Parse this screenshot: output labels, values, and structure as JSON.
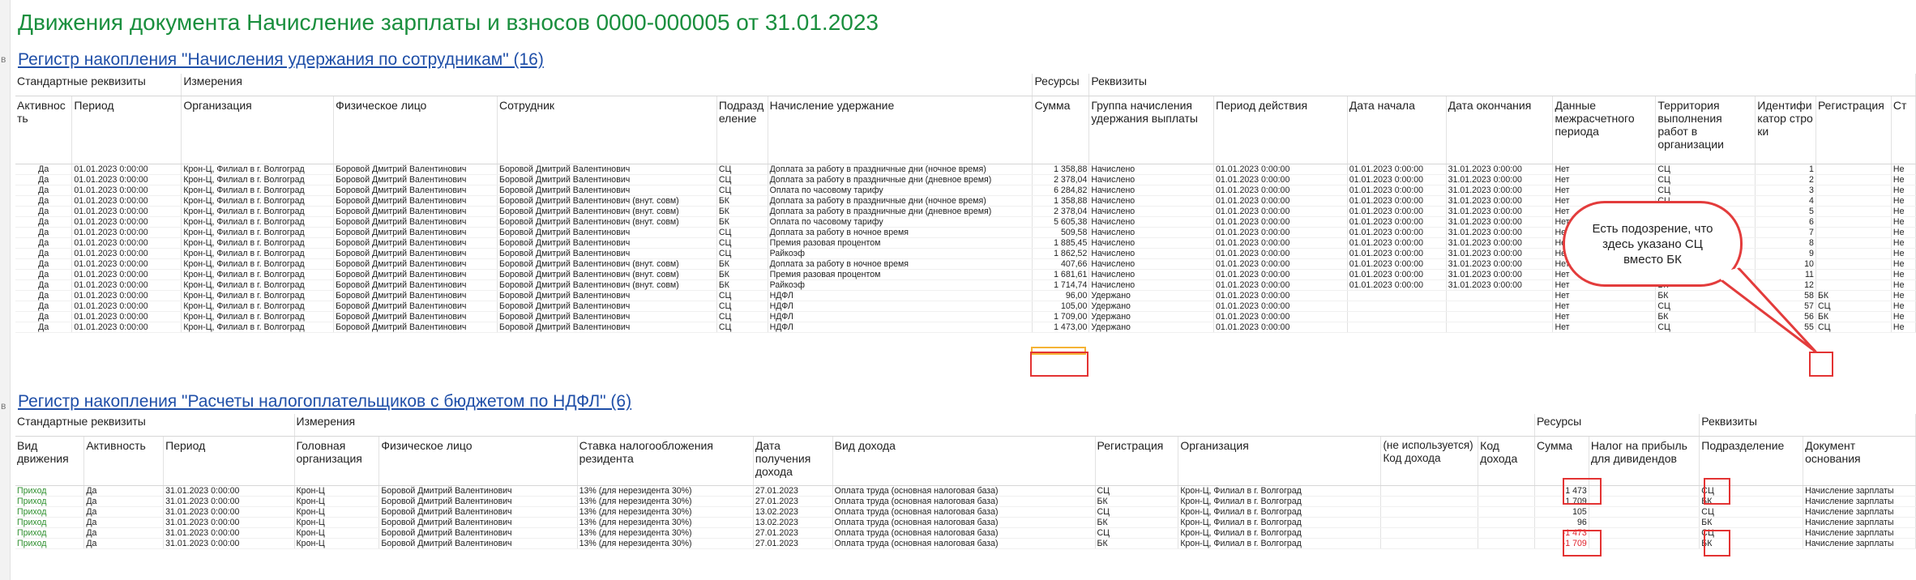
{
  "page": {
    "title": "Движения документа Начисление зарплаты и взносов 0000-000005 от 31.01.2023"
  },
  "register1": {
    "title": "Регистр накопления \"Начисления удержания по сотрудникам\" (16)",
    "groups": [
      "Стандартные реквизиты",
      "Измерения",
      "Ресурсы",
      "Реквизиты"
    ],
    "columns": [
      "Активность",
      "Период",
      "Организация",
      "Физическое лицо",
      "Сотрудник",
      "Подразделение",
      "Начисление удержание",
      "Сумма",
      "Группа начисления удержания выплаты",
      "Период действия",
      "Дата начала",
      "Дата окончания",
      "Данные межрасчетного периода",
      "Территория выполнения работ в организации",
      "Идентификатор строки",
      "Регистрация",
      "Ст"
    ],
    "rows": [
      [
        "Да",
        "01.01.2023 0:00:00",
        "Крон-Ц, Филиал в г. Волгоград",
        "Боровой Дмитрий Валентинович",
        "Боровой Дмитрий Валентинович",
        "СЦ",
        "Доплата за работу в праздничные дни (ночное время)",
        "1 358,88",
        "Начислено",
        "01.01.2023 0:00:00",
        "01.01.2023 0:00:00",
        "31.01.2023 0:00:00",
        "Нет",
        "СЦ",
        "1",
        "",
        "Не"
      ],
      [
        "Да",
        "01.01.2023 0:00:00",
        "Крон-Ц, Филиал в г. Волгоград",
        "Боровой Дмитрий Валентинович",
        "Боровой Дмитрий Валентинович",
        "СЦ",
        "Доплата за работу в праздничные дни (дневное время)",
        "2 378,04",
        "Начислено",
        "01.01.2023 0:00:00",
        "01.01.2023 0:00:00",
        "31.01.2023 0:00:00",
        "Нет",
        "СЦ",
        "2",
        "",
        "Не"
      ],
      [
        "Да",
        "01.01.2023 0:00:00",
        "Крон-Ц, Филиал в г. Волгоград",
        "Боровой Дмитрий Валентинович",
        "Боровой Дмитрий Валентинович",
        "СЦ",
        "Оплата по часовому тарифу",
        "6 284,82",
        "Начислено",
        "01.01.2023 0:00:00",
        "01.01.2023 0:00:00",
        "31.01.2023 0:00:00",
        "Нет",
        "СЦ",
        "3",
        "",
        "Не"
      ],
      [
        "Да",
        "01.01.2023 0:00:00",
        "Крон-Ц, Филиал в г. Волгоград",
        "Боровой Дмитрий Валентинович",
        "Боровой Дмитрий Валентинович (внут. совм)",
        "БК",
        "Доплата за работу в праздничные дни (ночное время)",
        "1 358,88",
        "Начислено",
        "01.01.2023 0:00:00",
        "01.01.2023 0:00:00",
        "31.01.2023 0:00:00",
        "Нет",
        "СЦ",
        "4",
        "",
        "Не"
      ],
      [
        "Да",
        "01.01.2023 0:00:00",
        "Крон-Ц, Филиал в г. Волгоград",
        "Боровой Дмитрий Валентинович",
        "Боровой Дмитрий Валентинович (внут. совм)",
        "БК",
        "Доплата за работу в праздничные дни (дневное время)",
        "2 378,04",
        "Начислено",
        "01.01.2023 0:00:00",
        "01.01.2023 0:00:00",
        "31.01.2023 0:00:00",
        "Нет",
        "СЦ",
        "5",
        "",
        "Не"
      ],
      [
        "Да",
        "01.01.2023 0:00:00",
        "Крон-Ц, Филиал в г. Волгоград",
        "Боровой Дмитрий Валентинович",
        "Боровой Дмитрий Валентинович (внут. совм)",
        "БК",
        "Оплата по часовому тарифу",
        "5 605,38",
        "Начислено",
        "01.01.2023 0:00:00",
        "01.01.2023 0:00:00",
        "31.01.2023 0:00:00",
        "Нет",
        "СЦ",
        "6",
        "",
        "Не"
      ],
      [
        "Да",
        "01.01.2023 0:00:00",
        "Крон-Ц, Филиал в г. Волгоград",
        "Боровой Дмитрий Валентинович",
        "Боровой Дмитрий Валентинович",
        "СЦ",
        "Доплата за работу в ночное время",
        "509,58",
        "Начислено",
        "01.01.2023 0:00:00",
        "01.01.2023 0:00:00",
        "31.01.2023 0:00:00",
        "Нет",
        "СЦ",
        "7",
        "",
        "Не"
      ],
      [
        "Да",
        "01.01.2023 0:00:00",
        "Крон-Ц, Филиал в г. Волгоград",
        "Боровой Дмитрий Валентинович",
        "Боровой Дмитрий Валентинович",
        "СЦ",
        "Премия разовая процентом",
        "1 885,45",
        "Начислено",
        "01.01.2023 0:00:00",
        "01.01.2023 0:00:00",
        "31.01.2023 0:00:00",
        "Нет",
        "СЦ",
        "8",
        "",
        "Не"
      ],
      [
        "Да",
        "01.01.2023 0:00:00",
        "Крон-Ц, Филиал в г. Волгоград",
        "Боровой Дмитрий Валентинович",
        "Боровой Дмитрий Валентинович",
        "СЦ",
        "Райкоэф",
        "1 862,52",
        "Начислено",
        "01.01.2023 0:00:00",
        "01.01.2023 0:00:00",
        "31.01.2023 0:00:00",
        "Не",
        "",
        "9",
        "",
        "Не"
      ],
      [
        "Да",
        "01.01.2023 0:00:00",
        "Крон-Ц, Филиал в г. Волгоград",
        "Боровой Дмитрий Валентинович",
        "Боровой Дмитрий Валентинович (внут. совм)",
        "БК",
        "Доплата за работу в ночное время",
        "407,66",
        "Начислено",
        "01.01.2023 0:00:00",
        "01.01.2023 0:00:00",
        "31.01.2023 0:00:00",
        "Нет",
        "БК",
        "10",
        "",
        "Не"
      ],
      [
        "Да",
        "01.01.2023 0:00:00",
        "Крон-Ц, Филиал в г. Волгоград",
        "Боровой Дмитрий Валентинович",
        "Боровой Дмитрий Валентинович (внут. совм)",
        "БК",
        "Премия разовая процентом",
        "1 681,61",
        "Начислено",
        "01.01.2023 0:00:00",
        "01.01.2023 0:00:00",
        "31.01.2023 0:00:00",
        "Нет",
        "БК",
        "11",
        "",
        "Не"
      ],
      [
        "Да",
        "01.01.2023 0:00:00",
        "Крон-Ц, Филиал в г. Волгоград",
        "Боровой Дмитрий Валентинович",
        "Боровой Дмитрий Валентинович (внут. совм)",
        "БК",
        "Райкоэф",
        "1 714,74",
        "Начислено",
        "01.01.2023 0:00:00",
        "01.01.2023 0:00:00",
        "31.01.2023 0:00:00",
        "Нет",
        "БК",
        "12",
        "",
        "Не"
      ],
      [
        "Да",
        "01.01.2023 0:00:00",
        "Крон-Ц, Филиал в г. Волгоград",
        "Боровой Дмитрий Валентинович",
        "Боровой Дмитрий Валентинович",
        "СЦ",
        "НДФЛ",
        "96,00",
        "Удержано",
        "01.01.2023 0:00:00",
        "",
        "",
        "Нет",
        "БК",
        "58",
        "БК",
        "Не"
      ],
      [
        "Да",
        "01.01.2023 0:00:00",
        "Крон-Ц, Филиал в г. Волгоград",
        "Боровой Дмитрий Валентинович",
        "Боровой Дмитрий Валентинович",
        "СЦ",
        "НДФЛ",
        "105,00",
        "Удержано",
        "01.01.2023 0:00:00",
        "",
        "",
        "Нет",
        "СЦ",
        "57",
        "СЦ",
        "Не"
      ],
      [
        "Да",
        "01.01.2023 0:00:00",
        "Крон-Ц, Филиал в г. Волгоград",
        "Боровой Дмитрий Валентинович",
        "Боровой Дмитрий Валентинович",
        "СЦ",
        "НДФЛ",
        "1 709,00",
        "Удержано",
        "01.01.2023 0:00:00",
        "",
        "",
        "Нет",
        "БК",
        "56",
        "БК",
        "Не"
      ],
      [
        "Да",
        "01.01.2023 0:00:00",
        "Крон-Ц, Филиал в г. Волгоград",
        "Боровой Дмитрий Валентинович",
        "Боровой Дмитрий Валентинович",
        "СЦ",
        "НДФЛ",
        "1 473,00",
        "Удержано",
        "01.01.2023 0:00:00",
        "",
        "",
        "Нет",
        "СЦ",
        "55",
        "СЦ",
        "Не"
      ]
    ]
  },
  "register2": {
    "title": "Регистр накопления \"Расчеты налогоплательщиков с бюджетом по НДФЛ\" (6)",
    "groups": [
      "Стандартные реквизиты",
      "Измерения",
      "Ресурсы",
      "Реквизиты"
    ],
    "columns": [
      "Вид движения",
      "Активность",
      "Период",
      "Головная организация",
      "Физическое лицо",
      "Ставка налогообложения резидента",
      "Дата получения дохода",
      "Вид дохода",
      "Регистрация",
      "Организация",
      "(не используется) Код дохода",
      "Код дохода",
      "Сумма",
      "Налог на прибыль для дивидендов",
      "Подразделение",
      "Документ основания"
    ],
    "rows": [
      [
        "Приход",
        "Да",
        "31.01.2023 0:00:00",
        "Крон-Ц",
        "Боровой Дмитрий Валентинович",
        "13% (для нерезидента 30%)",
        "27.01.2023",
        "Оплата труда (основная налоговая база)",
        "СЦ",
        "Крон-Ц, Филиал в г. Волгоград",
        "",
        "",
        "1 473",
        "",
        "СЦ",
        "Начисление зарплаты"
      ],
      [
        "Приход",
        "Да",
        "31.01.2023 0:00:00",
        "Крон-Ц",
        "Боровой Дмитрий Валентинович",
        "13% (для нерезидента 30%)",
        "27.01.2023",
        "Оплата труда (основная налоговая база)",
        "БК",
        "Крон-Ц, Филиал в г. Волгоград",
        "",
        "",
        "1 709",
        "",
        "БК",
        "Начисление зарплаты"
      ],
      [
        "Приход",
        "Да",
        "31.01.2023 0:00:00",
        "Крон-Ц",
        "Боровой Дмитрий Валентинович",
        "13% (для нерезидента 30%)",
        "13.02.2023",
        "Оплата труда (основная налоговая база)",
        "СЦ",
        "Крон-Ц, Филиал в г. Волгоград",
        "",
        "",
        "105",
        "",
        "СЦ",
        "Начисление зарплаты"
      ],
      [
        "Приход",
        "Да",
        "31.01.2023 0:00:00",
        "Крон-Ц",
        "Боровой Дмитрий Валентинович",
        "13% (для нерезидента 30%)",
        "13.02.2023",
        "Оплата труда (основная налоговая база)",
        "БК",
        "Крон-Ц, Филиал в г. Волгоград",
        "",
        "",
        "96",
        "",
        "БК",
        "Начисление зарплаты"
      ],
      [
        "Приход",
        "Да",
        "31.01.2023 0:00:00",
        "Крон-Ц",
        "Боровой Дмитрий Валентинович",
        "13% (для нерезидента 30%)",
        "27.01.2023",
        "Оплата труда (основная налоговая база)",
        "СЦ",
        "Крон-Ц, Филиал в г. Волгоград",
        "",
        "",
        "-1 473",
        "",
        "СЦ",
        "Начисление зарплаты"
      ],
      [
        "Приход",
        "Да",
        "31.01.2023 0:00:00",
        "Крон-Ц",
        "Боровой Дмитрий Валентинович",
        "13% (для нерезидента 30%)",
        "27.01.2023",
        "Оплата труда (основная налоговая база)",
        "БК",
        "Крон-Ц, Филиал в г. Волгоград",
        "",
        "",
        "-1 709",
        "",
        "БК",
        "Начисление зарплаты"
      ]
    ]
  },
  "callout": {
    "text": "Есть подозрение, что\nздесь указано СЦ\nвместо БК"
  },
  "colors": {
    "title": "#1a8f3e",
    "register_link": "#1f4fa8",
    "highlight": "#e33333",
    "highlight_orange": "#f5b335",
    "movement_type": "#2f8f2f",
    "negative": "#e0202a"
  }
}
